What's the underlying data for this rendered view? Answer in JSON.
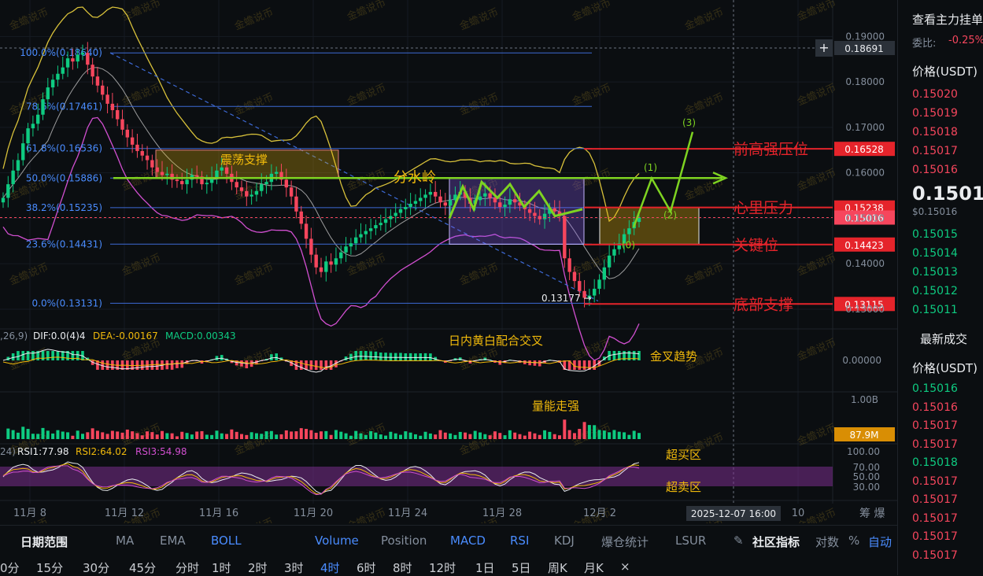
{
  "colors": {
    "up": "#0ecb81",
    "down": "#f6465d",
    "fib": "#3d6ad6",
    "yellow": "#f0b90b",
    "boll_upper": "#d8c13a",
    "boll_lower": "#d14fd0",
    "boll_mid": "#c0c0c0",
    "annot_red": "#e5242b",
    "annot_green": "#7ed321"
  },
  "watermark": "金蟾说币",
  "chart_data": {
    "type": "candlestick",
    "x_ticks": [
      "11月 8",
      "11月 12",
      "11月 16",
      "11月 20",
      "11月 24",
      "11月 28",
      "12月 2",
      "10"
    ],
    "y_ticks": [
      "0.19000",
      "0.18000",
      "0.17000",
      "0.16000",
      "0.15000",
      "0.14000",
      "0.13000"
    ],
    "ylim": [
      0.1267,
      0.1918
    ],
    "close_series": [
      0.1545,
      0.1575,
      0.1605,
      0.1628,
      0.1665,
      0.1698,
      0.1708,
      0.1728,
      0.1762,
      0.1788,
      0.1805,
      0.1818,
      0.1832,
      0.1852,
      0.1845,
      0.186,
      0.1864,
      0.1838,
      0.1812,
      0.1792,
      0.1772,
      0.1752,
      0.1738,
      0.1718,
      0.1695,
      0.1678,
      0.1662,
      0.1648,
      0.1638,
      0.1628,
      0.1612,
      0.1602,
      0.1595,
      0.1598,
      0.1585,
      0.1582,
      0.1575,
      0.1585,
      0.1595,
      0.1592,
      0.1575,
      0.1578,
      0.159,
      0.1605,
      0.1612,
      0.1598,
      0.158,
      0.1568,
      0.156,
      0.1548,
      0.1552,
      0.156,
      0.1575,
      0.158,
      0.1598,
      0.1602,
      0.1585,
      0.1568,
      0.1548,
      0.1515,
      0.1488,
      0.1455,
      0.142,
      0.1392,
      0.1382,
      0.1405,
      0.1398,
      0.1412,
      0.1425,
      0.1438,
      0.1445,
      0.1458,
      0.1465,
      0.1472,
      0.1478,
      0.1485,
      0.149,
      0.1498,
      0.1505,
      0.1512,
      0.152,
      0.1525,
      0.1532,
      0.1538,
      0.1545,
      0.1552,
      0.1558,
      0.1548,
      0.1535,
      0.1528,
      0.154,
      0.1552,
      0.1558,
      0.1545,
      0.1532,
      0.154,
      0.1548,
      0.1555,
      0.1545,
      0.1535,
      0.1525,
      0.153,
      0.1542,
      0.1535,
      0.1528,
      0.152,
      0.1512,
      0.1505,
      0.1498,
      0.151,
      0.1522,
      0.1515,
      0.1505,
      0.1412,
      0.1382,
      0.1362,
      0.134,
      0.1325,
      0.133,
      0.1345,
      0.1365,
      0.1392,
      0.1418,
      0.1432,
      0.1445,
      0.1465,
      0.1478,
      0.1492,
      0.1502
    ],
    "fib_levels": [
      {
        "label": "100.0%(0.18640)",
        "value": 0.1864
      },
      {
        "label": "78.6%(0.17461)",
        "value": 0.17461
      },
      {
        "label": "61.8%(0.16536)",
        "value": 0.16536
      },
      {
        "label": "50.0%(0.15886)",
        "value": 0.15886
      },
      {
        "label": "38.2%(0.15235)",
        "value": 0.15235
      },
      {
        "label": "23.6%(0.14431)",
        "value": 0.14431
      },
      {
        "label": "0.0%(0.13131)",
        "value": 0.13131
      }
    ],
    "levels": [
      {
        "name": "前高强压位",
        "value": 0.16528
      },
      {
        "name": "心里压力",
        "value": 0.15238
      },
      {
        "name": "关键位",
        "value": 0.14423
      },
      {
        "name": "底部支撑",
        "value": 0.13115
      }
    ],
    "current_price": 0.15016,
    "crosshair_price": "0.18691",
    "low_label": "0.13177 →",
    "cursor_time": "2025-12-07 16:00",
    "macd_panel": {
      "legend_prefix": ",26,9)",
      "dif": "DIF:0.0(4)4",
      "dea": "DEA:-0.00167",
      "macd": "MACD:0.00343",
      "right_tick": "0.00000"
    },
    "volume_panel": {
      "right_tick": "1.00B",
      "current": "87.9M"
    },
    "rsi_panel": {
      "legend_prefix": "24)",
      "rsi1": "RSI1:77.98",
      "rsi2": "RSI2:64.02",
      "rsi3": "RSI3:54.98",
      "ticks": [
        "100.00",
        "70.00",
        "50.00",
        "30.00"
      ]
    },
    "annotations": {
      "range_support": "震荡支撑",
      "watershed": "分水岭",
      "cross": "日内黄白配合交叉",
      "golden_cross": "金叉趋势",
      "volume_strong": "量能走强",
      "overbought": "超买区",
      "oversold": "超卖区",
      "wave0": "(0)",
      "wave1": "(1)",
      "wave2": "(2)",
      "wave3": "(3)"
    },
    "axis_corner": "筹  爆"
  },
  "sidebar": {
    "title": "查看主力挂单",
    "ratio_label": "委比:",
    "ratio_value": "-0.25%",
    "price_header": "价格(USDT)",
    "asks": [
      "0.15020",
      "0.15019",
      "0.15018",
      "0.15017",
      "0.15016"
    ],
    "last_price": "0.15016",
    "last_price_sub": "$0.15016",
    "bids": [
      "0.15015",
      "0.15014",
      "0.15013",
      "0.15012",
      "0.15011"
    ],
    "trades_title": "最新成交",
    "trades_header": "价格(USDT)",
    "trades": [
      {
        "p": "0.15016",
        "c": "green"
      },
      {
        "p": "0.15016",
        "c": "red"
      },
      {
        "p": "0.15017",
        "c": "red"
      },
      {
        "p": "0.15017",
        "c": "red"
      },
      {
        "p": "0.15018",
        "c": "green"
      },
      {
        "p": "0.15017",
        "c": "red"
      },
      {
        "p": "0.15017",
        "c": "red"
      },
      {
        "p": "0.15017",
        "c": "red"
      },
      {
        "p": "0.15017",
        "c": "red"
      },
      {
        "p": "0.15017",
        "c": "red"
      }
    ]
  },
  "toolbar": {
    "date_range": "日期范围",
    "indicators": [
      "MA",
      "EMA",
      "BOLL"
    ],
    "sub_indicators": [
      "Volume",
      "Position",
      "MACD",
      "RSI",
      "KDJ",
      "爆仓统计",
      "LSUR"
    ],
    "community": "社区指标",
    "log": "对数",
    "pct": "%",
    "auto": "自动"
  },
  "intervals": [
    "0分",
    "15分",
    "30分",
    "45分",
    "分时",
    "1时",
    "2时",
    "3时",
    "4时",
    "6时",
    "8时",
    "12时",
    "1日",
    "5日",
    "周K",
    "月K",
    "×"
  ],
  "active_interval": "4时"
}
